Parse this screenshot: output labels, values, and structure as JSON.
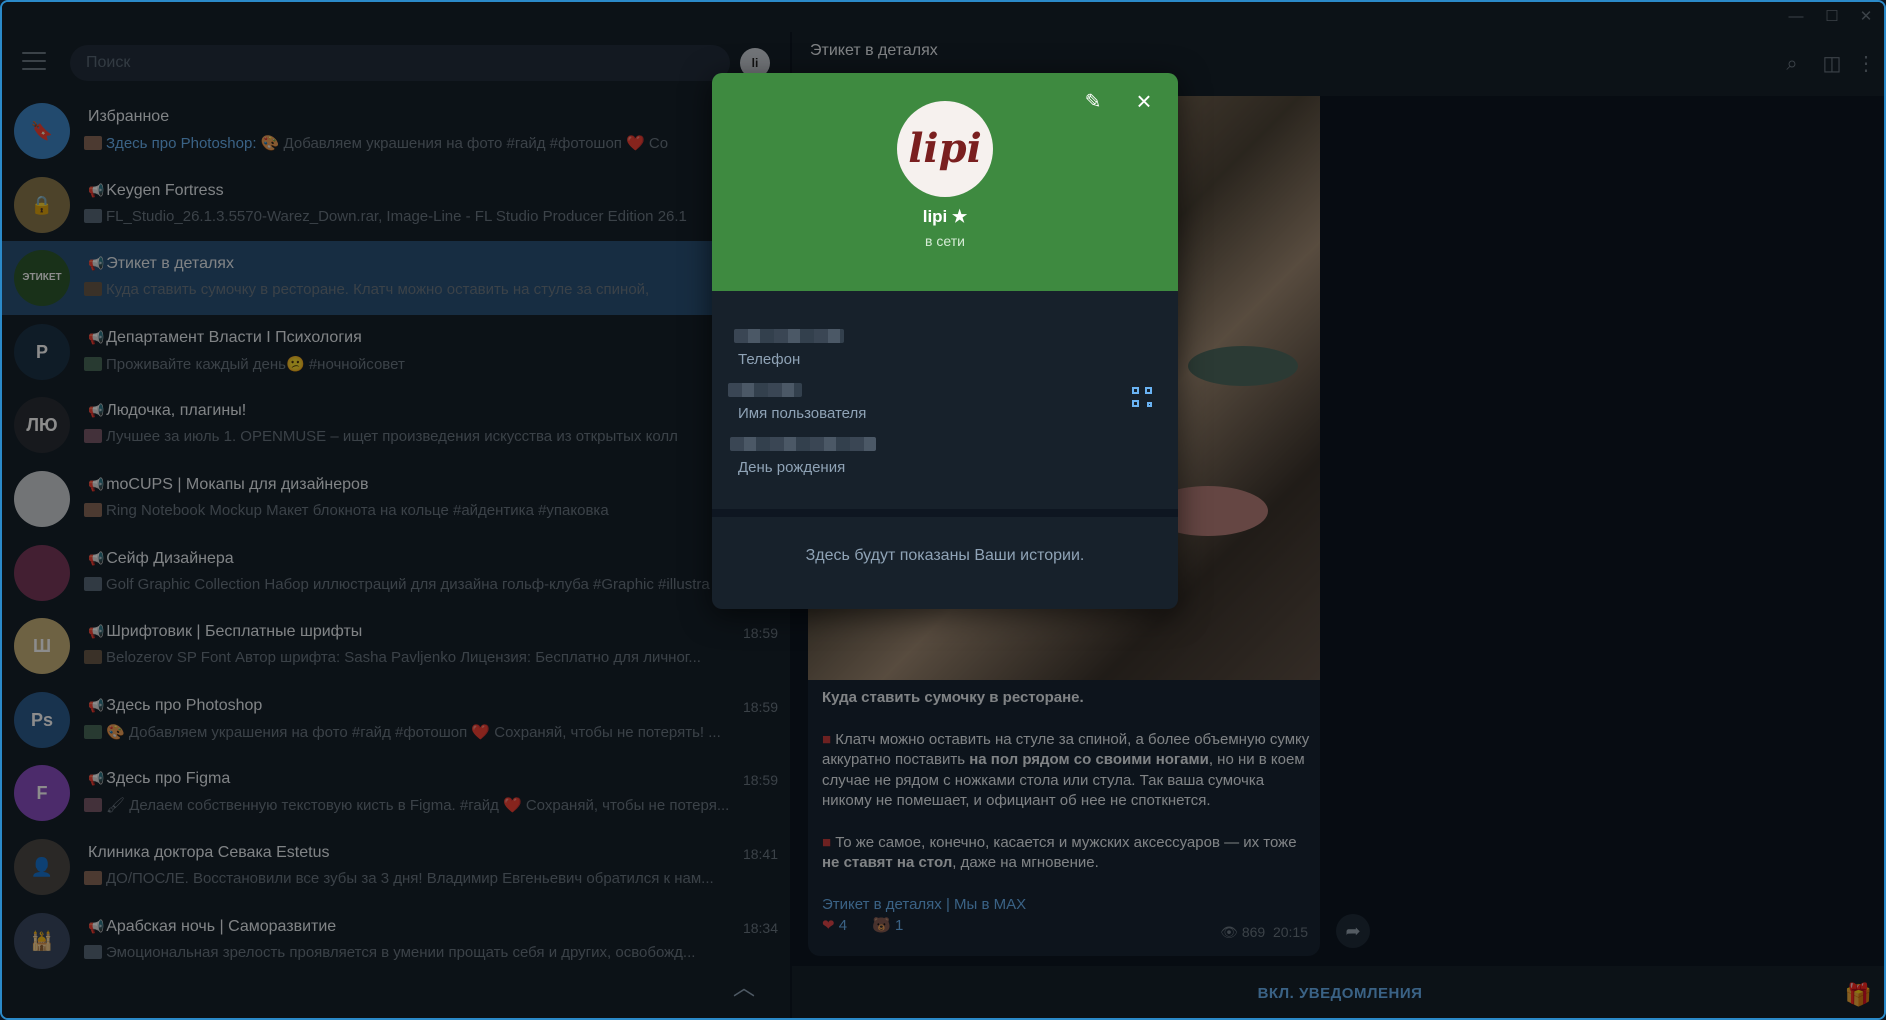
{
  "window": {
    "minimize_icon": "minimize-icon",
    "maximize_icon": "maximize-icon",
    "close_icon": "close-icon"
  },
  "sidebar": {
    "search_placeholder": "Поиск",
    "chats": [
      {
        "title": "Избранное",
        "preview_link": "Здесь про Photoshop:",
        "preview": "🎨 Добавляем украшения на фото #гайд #фотошоп  ❤️ Со",
        "time": "",
        "channel": false,
        "avatar_color": "#3e88c8",
        "avatar_text": "🔖"
      },
      {
        "title": "Keygen Fortress",
        "preview": "FL_Studio_26.1.3.5570-Warez_Down.rar, Image-Line - FL Studio Producer Edition 26.1",
        "time": "",
        "channel": true,
        "avatar_color": "#8d7b4e",
        "avatar_text": "🔒"
      },
      {
        "title": "Этикет в деталях",
        "preview": "Куда ставить сумочку в ресторане.  Клатч можно оставить на стуле за спиной,",
        "time": "",
        "channel": true,
        "active": true,
        "avatar_color": "#2e5a2e",
        "avatar_text": "ЭТИКЕТ"
      },
      {
        "title": "Департамент Власти I Психология",
        "preview": "Проживайте каждый день😕  #ночнойсовет",
        "time": "",
        "channel": true,
        "avatar_color": "#1d3347",
        "avatar_text": "P"
      },
      {
        "title": "Людочка, плагины!",
        "preview": "Лучшее за июль  1. OPENMUSE – ищет произведения искусства из открытых колл",
        "time": "",
        "channel": true,
        "avatar_color": "#2a2f36",
        "avatar_text": "ЛЮ"
      },
      {
        "title": "moCUPS | Мокапы для дизайнеров",
        "preview": "Ring Notebook Mockup  Макет блокнота на кольце  #айдентика #упаковка",
        "time": "",
        "channel": true,
        "avatar_color": "#cfd3d8",
        "avatar_text": ""
      },
      {
        "title": "Сейф Дизайнера",
        "preview": "Golf Graphic Collection  Набор иллюстраций для дизайна гольф-клуба  #Graphic #illustra",
        "time": "",
        "channel": true,
        "avatar_color": "#7a3a5c",
        "avatar_text": ""
      },
      {
        "title": "Шрифтовик | Бесплатные шрифты",
        "preview": "Belozerov SP Font  Автор шрифта: Sasha Pavljenko Лицензия: Бесплатно для личног...",
        "time": "18:59",
        "channel": true,
        "avatar_color": "#c9b27a",
        "avatar_text": "Ш"
      },
      {
        "title": "Здесь про Photoshop",
        "preview": "🎨 Добавляем украшения на фото #гайд #фотошоп  ❤️ Сохраняй, чтобы не потерять! ...",
        "time": "18:59",
        "channel": true,
        "avatar_color": "#2c5d8f",
        "avatar_text": "Ps"
      },
      {
        "title": "Здесь про Figma",
        "preview": "🖌 Делаем собственную текстовую кисть в Figma. #гайд  ❤️ Сохраняй, чтобы не потеря...",
        "time": "18:59",
        "channel": true,
        "avatar_color": "#8a4fc3",
        "avatar_text": "F"
      },
      {
        "title": "Клиника доктора Севака Estetus",
        "preview": "ДО/ПОСЛЕ. Восстановили все зубы за 3 дня!  Владимир Евгеньевич обратился к нам...",
        "time": "18:41",
        "channel": false,
        "avatar_color": "#4d4a46",
        "avatar_text": "👤"
      },
      {
        "title": "Арабская ночь | Саморазвитие",
        "preview": "Эмоциональная зрелость проявляется в умении прощать себя и других, освобожд...",
        "time": "18:34",
        "channel": true,
        "avatar_color": "#3b4a63",
        "avatar_text": "🕌"
      }
    ]
  },
  "chat": {
    "title": "Этикет в деталях",
    "subtitle": "",
    "post": {
      "heading": "Куда ставить сумочку в ресторане.",
      "p1_a": "Клатч можно оставить на стуле за спиной, а более объемную сумку аккуратно поставить ",
      "p1_b": "на пол рядом со своими ногами",
      "p1_c": ", но ни в коем случае не рядом с ножками стола или стула. Так ваша сумочка никому не помешает, и официант об нее не споткнется.",
      "p2_a": "То же самое, конечно, касается и мужских аксессуаров — их тоже ",
      "p2_b": "не ставят на стол",
      "p2_c": ", даже на мгновение.",
      "link1": "Этикет в деталях",
      "link_sep": " | ",
      "link2": "Мы в MAX",
      "reaction1_count": "4",
      "reaction2_count": "1",
      "views": "869",
      "time": "20:15"
    },
    "notify_button": "ВКЛ. УВЕДОМЛЕНИЯ"
  },
  "profile_modal": {
    "avatar_text": "lipi",
    "name": "lipi",
    "status": "в сети",
    "phone_label": "Телефон",
    "username_label": "Имя пользователя",
    "birthday_label": "День рождения",
    "stories_text": "Здесь будут показаны Ваши истории.",
    "header_color": "#3e8a40"
  }
}
